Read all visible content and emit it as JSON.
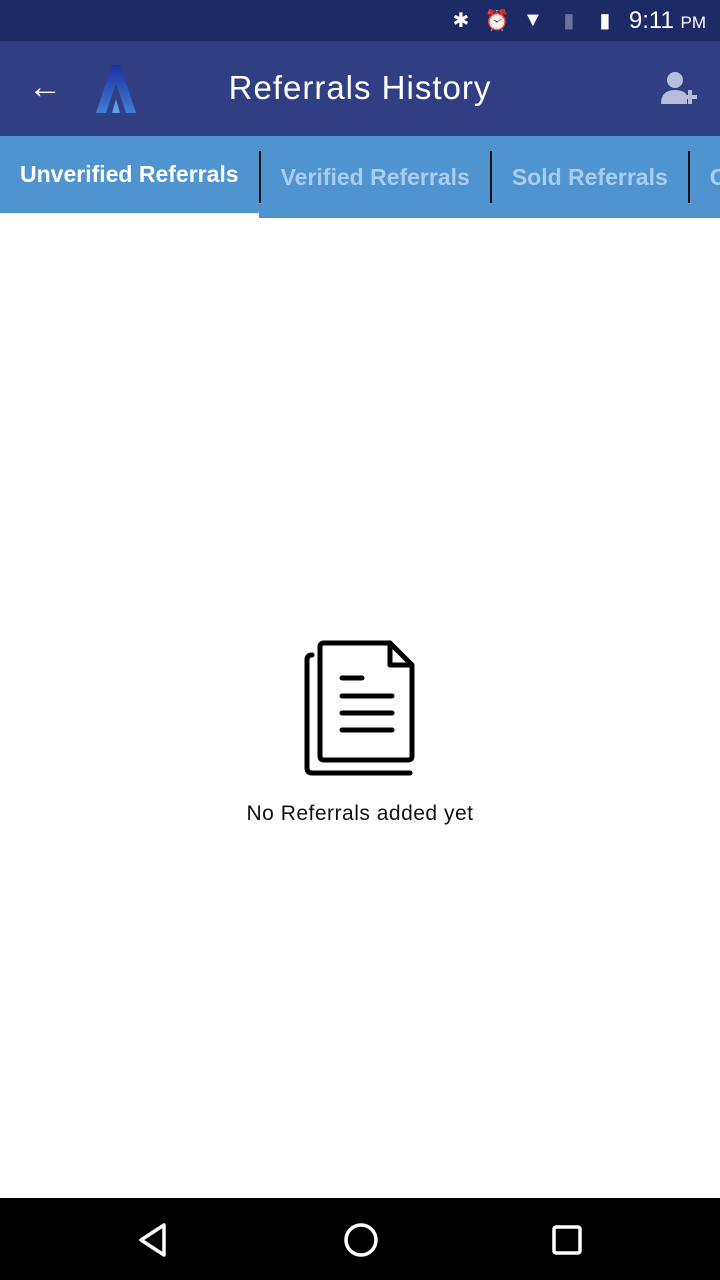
{
  "status_bar": {
    "time": "9:11",
    "ampm": "PM",
    "icons": [
      "bluetooth-icon",
      "alarm-icon",
      "wifi-icon",
      "no-sim-icon",
      "battery-icon"
    ]
  },
  "app_bar": {
    "title": "Referrals History",
    "back_icon": "arrow-left-icon",
    "action_icon": "add-user-icon"
  },
  "tabs": [
    {
      "label": "Unverified Referrals",
      "active": true
    },
    {
      "label": "Verified Referrals"
    },
    {
      "label": "Sold Referrals"
    },
    {
      "label": "Closed Referrals"
    }
  ],
  "empty_state": {
    "icon": "documents-icon",
    "message": "No Referrals added yet"
  },
  "colors": {
    "status_bar": "#1c2a66",
    "app_bar": "#303f83",
    "tab_bar": "#4f94cf",
    "tab_inactive_text": "#a9cdf0"
  }
}
